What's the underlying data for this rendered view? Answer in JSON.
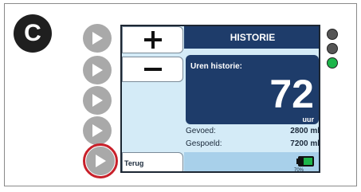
{
  "badge": {
    "letter": "C"
  },
  "soft_keys": {
    "plus": "+",
    "minus": "−",
    "back_label": "Terug"
  },
  "screen": {
    "header_title": "HISTORIE",
    "hours_title": "Uren historie:",
    "hours_value": "72",
    "hours_unit": "uur",
    "stats": [
      {
        "label": "Gevoed:",
        "value": "2800 ml"
      },
      {
        "label": "Gespoeld:",
        "value": "7200 ml"
      }
    ],
    "battery_percent": "70%"
  },
  "indicator_lights": [
    {
      "state": "off",
      "color": "#555555"
    },
    {
      "state": "off",
      "color": "#555555"
    },
    {
      "state": "on",
      "color": "#1db54a"
    }
  ],
  "colors": {
    "header_bg": "#1e3c6a",
    "screen_bg": "#d4ebf7",
    "highlight_ring": "#c8202a",
    "battery_fill": "#1db54a"
  }
}
